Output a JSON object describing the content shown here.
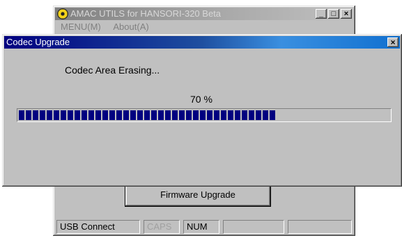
{
  "main_window": {
    "title": "AMAC UTILS for HANSORI-320 Beta",
    "menu": [
      "MENU(M)",
      "About(A)"
    ],
    "controls": {
      "minimize": "_",
      "maximize": "□",
      "close": "×"
    },
    "firmware_button_label": "Firmware Upgrade",
    "statusbar": {
      "connection": "USB Connect",
      "caps": "CAPS",
      "num": "NUM"
    }
  },
  "dialog": {
    "title": "Codec Upgrade",
    "close_symbol": "×",
    "status_message": "Codec Area Erasing...",
    "percent_label": "70 %",
    "progress_fraction": 0.7
  },
  "colors": {
    "dialog_title_start": "#000080",
    "dialog_title_end": "#3a8fe0",
    "progress_block": "#000080",
    "window_face": "#c0c0c0"
  },
  "icons": [
    "app-icon",
    "minimize-icon",
    "maximize-icon",
    "close-icon"
  ]
}
